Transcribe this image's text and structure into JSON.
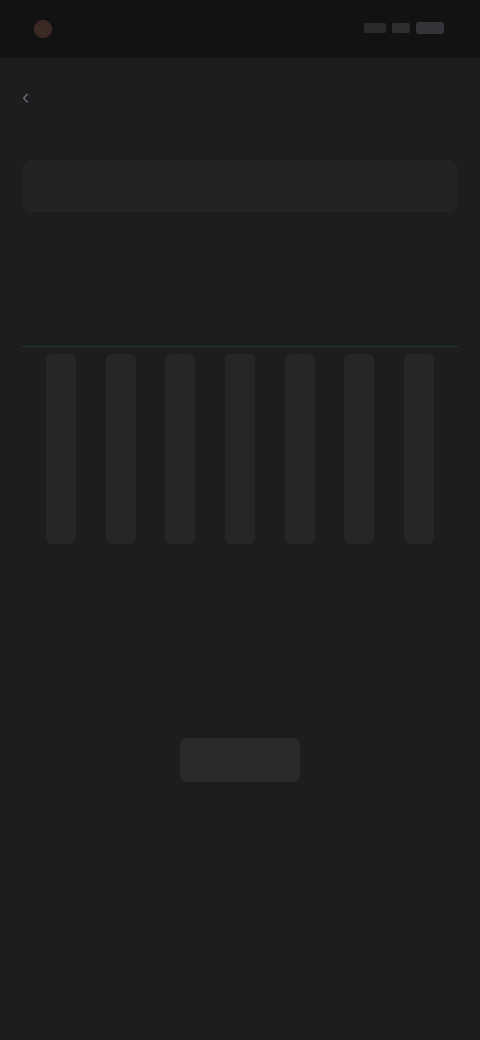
{
  "status_bar": {
    "time": "",
    "icons": [
      "app-dot-icon",
      "signal-icon",
      "wifi-icon",
      "battery-icon"
    ]
  },
  "header": {
    "back_icon": "chevron-left-icon",
    "title": ""
  },
  "segmented": {
    "options": [
      "",
      "",
      ""
    ],
    "active_index": 1
  },
  "summary": {
    "left_value": "",
    "left_label": "",
    "right_value": "",
    "right_label": ""
  },
  "chart_data": {
    "type": "bar",
    "categories": [
      "",
      "",
      "",
      "",
      "",
      "",
      ""
    ],
    "values": [
      0,
      0,
      0,
      0,
      0,
      0,
      0
    ],
    "ylim": [
      0,
      1
    ],
    "grid": false
  },
  "section": {
    "title": ""
  },
  "empty_state": {
    "icon": "empty-illustration-icon",
    "title": "",
    "subtitle": ""
  },
  "colors": {
    "background": "#1d1d1f",
    "status_bar": "#121213",
    "accent_green": "#1f3a2a"
  }
}
